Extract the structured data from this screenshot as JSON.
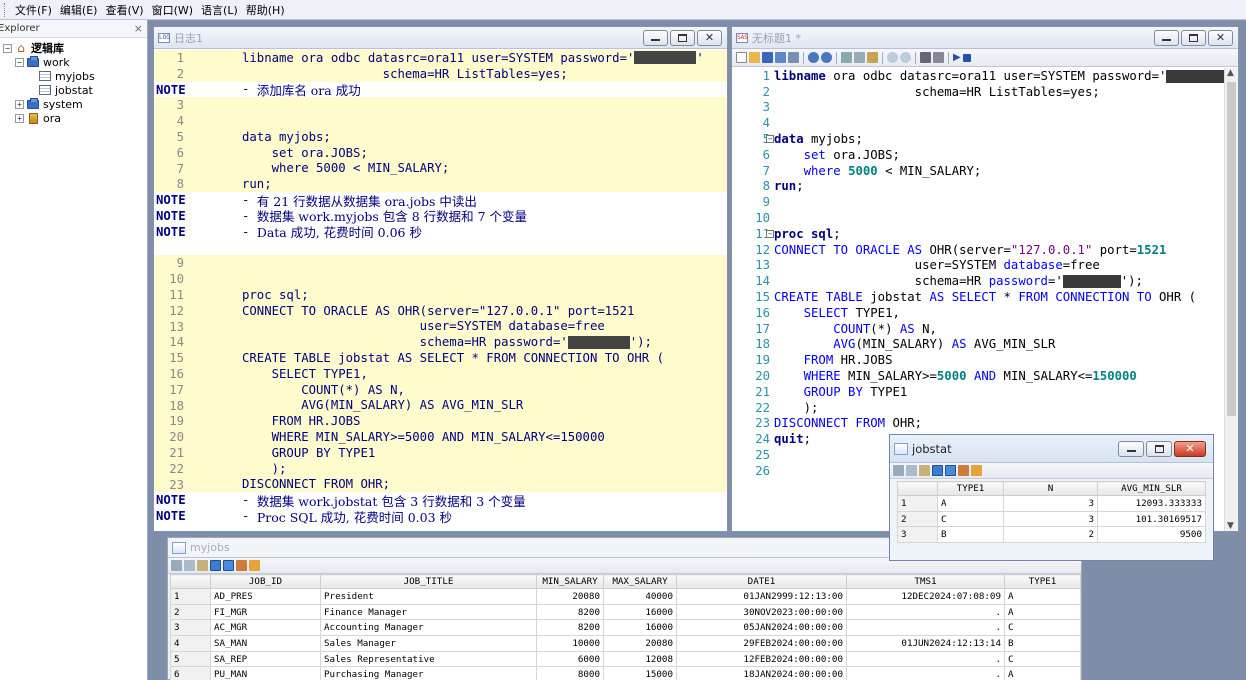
{
  "menu": [
    "文件(F)",
    "编辑(E)",
    "查看(V)",
    "窗口(W)",
    "语言(L)",
    "帮助(H)"
  ],
  "explorer": {
    "title": "Explorer",
    "close": "×",
    "root": "逻辑库",
    "work": "work",
    "myjobs": "myjobs",
    "jobstat": "jobstat",
    "system": "system",
    "ora": "ora"
  },
  "log": {
    "title": "日志1",
    "lines": [
      {
        "t": "src",
        "n": "1",
        "c": "libname ora odbc datasrc=ora11 user=SYSTEM password='",
        "mask": true,
        "after": "'"
      },
      {
        "t": "src",
        "n": "2",
        "c": "                   schema=HR ListTables=yes;"
      },
      {
        "t": "note",
        "k": "NOTE",
        "c": "添加库名 ora 成功"
      },
      {
        "t": "src",
        "n": "3",
        "c": ""
      },
      {
        "t": "src",
        "n": "4",
        "c": ""
      },
      {
        "t": "src",
        "n": "5",
        "c": "data myjobs;"
      },
      {
        "t": "src",
        "n": "6",
        "c": "    set ora.JOBS;"
      },
      {
        "t": "src",
        "n": "7",
        "c": "    where 5000 < MIN_SALARY;"
      },
      {
        "t": "src",
        "n": "8",
        "c": "run;"
      },
      {
        "t": "note",
        "k": "NOTE",
        "c": "有 21 行数据从数据集 ora.jobs 中读出"
      },
      {
        "t": "note",
        "k": "NOTE",
        "c": "数据集 work.myjobs 包含 8 行数据和 7 个变量"
      },
      {
        "t": "note",
        "k": "NOTE",
        "c": "Data 成功, 花费时间 0.06 秒"
      },
      {
        "t": "blank"
      },
      {
        "t": "src",
        "n": "9",
        "c": ""
      },
      {
        "t": "src",
        "n": "10",
        "c": ""
      },
      {
        "t": "src",
        "n": "11",
        "c": "proc sql;"
      },
      {
        "t": "src",
        "n": "12",
        "c": "CONNECT TO ORACLE AS OHR(server=\"127.0.0.1\" port=1521"
      },
      {
        "t": "src",
        "n": "13",
        "c": "                        user=SYSTEM database=free"
      },
      {
        "t": "src",
        "n": "14",
        "c": "                        schema=HR password='",
        "mask": true,
        "after": "');"
      },
      {
        "t": "src",
        "n": "15",
        "c": "CREATE TABLE jobstat AS SELECT * FROM CONNECTION TO OHR ("
      },
      {
        "t": "src",
        "n": "16",
        "c": "    SELECT TYPE1,"
      },
      {
        "t": "src",
        "n": "17",
        "c": "        COUNT(*) AS N,"
      },
      {
        "t": "src",
        "n": "18",
        "c": "        AVG(MIN_SALARY) AS AVG_MIN_SLR"
      },
      {
        "t": "src",
        "n": "19",
        "c": "    FROM HR.JOBS"
      },
      {
        "t": "src",
        "n": "20",
        "c": "    WHERE MIN_SALARY>=5000 AND MIN_SALARY<=150000"
      },
      {
        "t": "src",
        "n": "21",
        "c": "    GROUP BY TYPE1"
      },
      {
        "t": "src",
        "n": "22",
        "c": "    );"
      },
      {
        "t": "src",
        "n": "23",
        "c": "DISCONNECT FROM OHR;"
      },
      {
        "t": "note",
        "k": "NOTE",
        "c": "数据集 work.jobstat 包含 3 行数据和 3 个变量"
      },
      {
        "t": "note",
        "k": "NOTE",
        "c": "Proc SQL 成功, 花费时间 0.03 秒"
      }
    ]
  },
  "editor": {
    "title": "无标题1 *",
    "line_numbers": [
      "1",
      "2",
      "3",
      "4",
      "5",
      "6",
      "7",
      "8",
      "9",
      "10",
      "11",
      "12",
      "13",
      "14",
      "15",
      "16",
      "17",
      "18",
      "19",
      "20",
      "21",
      "22",
      "23",
      "24",
      "25",
      "26"
    ]
  },
  "jobstat": {
    "title": "jobstat",
    "headers": [
      "",
      "TYPE1",
      "N",
      "AVG_MIN_SLR"
    ],
    "rows": [
      [
        "1",
        "A",
        "3",
        "12093.333333"
      ],
      [
        "2",
        "C",
        "3",
        "101.30169517"
      ],
      [
        "3",
        "B",
        "2",
        "9500"
      ]
    ]
  },
  "myjobs": {
    "title": "myjobs",
    "headers": [
      "",
      "JOB_ID",
      "JOB_TITLE",
      "MIN_SALARY",
      "MAX_SALARY",
      "DATE1",
      "TMS1",
      "TYPE1"
    ],
    "rows": [
      [
        "1",
        "AD_PRES",
        "President",
        "20080",
        "40000",
        "01JAN2999:12:13:00",
        "12DEC2024:07:08:09",
        "A"
      ],
      [
        "2",
        "FI_MGR",
        "Finance Manager",
        "8200",
        "16000",
        "30NOV2023:00:00:00",
        ".",
        "A"
      ],
      [
        "3",
        "AC_MGR",
        "Accounting Manager",
        "8200",
        "16000",
        "05JAN2024:00:00:00",
        ".",
        "C"
      ],
      [
        "4",
        "SA_MAN",
        "Sales Manager",
        "10000",
        "20080",
        "29FEB2024:00:00:00",
        "01JUN2024:12:13:14",
        "B"
      ],
      [
        "5",
        "SA_REP",
        "Sales Representative",
        "6000",
        "12008",
        "12FEB2024:00:00:00",
        ".",
        "C"
      ],
      [
        "6",
        "PU_MAN",
        "Purchasing Manager",
        "8000",
        "15000",
        "18JAN2024:00:00:00",
        ".",
        "A"
      ]
    ]
  }
}
